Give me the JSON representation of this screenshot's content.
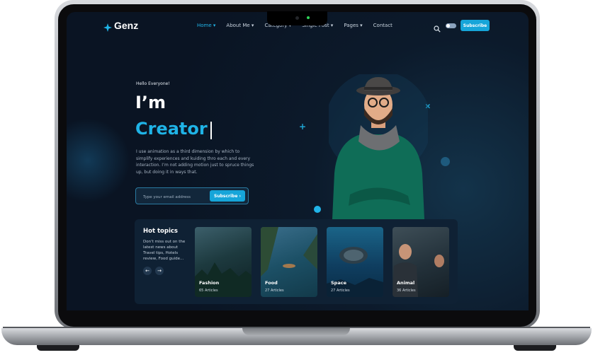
{
  "brand": {
    "name": "Genz",
    "accent": "#16a5d9"
  },
  "nav": {
    "items": [
      {
        "label": "Home",
        "active": true,
        "dropdown": true
      },
      {
        "label": "About Me",
        "active": false,
        "dropdown": true
      },
      {
        "label": "Category",
        "active": false,
        "dropdown": true
      },
      {
        "label": "Single Post",
        "active": false,
        "dropdown": true
      },
      {
        "label": "Pages",
        "active": false,
        "dropdown": true
      },
      {
        "label": "Contact",
        "active": false,
        "dropdown": false
      }
    ],
    "subscribe_label": "Subscribe",
    "search_icon": "search-icon",
    "theme_toggle_icon": "theme-toggle"
  },
  "hero": {
    "greeting": "Hello Everyone!",
    "headline": "I’m",
    "role": "Creator",
    "description": "I use animation as a third dimension by which to simplify experiences and kuiding thro each and every interaction. I’m not adding motion just to spruce things up, but doing it in ways that.",
    "email_placeholder": "Type your email address",
    "subscribe_label": "Subscribe",
    "subscribe_icon": "arrow-right-icon"
  },
  "hot_topics": {
    "title": "Hot topics",
    "description": "Don't miss out on the latest news about Travel tips, Hotels review, Food guide...",
    "prev_icon": "arrow-left-icon",
    "next_icon": "arrow-right-icon",
    "cards": [
      {
        "title": "Fashion",
        "subtitle": "65 Articles"
      },
      {
        "title": "Food",
        "subtitle": "27 Articles"
      },
      {
        "title": "Space",
        "subtitle": "27 Articles"
      },
      {
        "title": "Animal",
        "subtitle": "36 Articles"
      }
    ]
  },
  "colors": {
    "background": "#0a1423",
    "accent": "#16a5d9",
    "panel": "#0f2134"
  }
}
